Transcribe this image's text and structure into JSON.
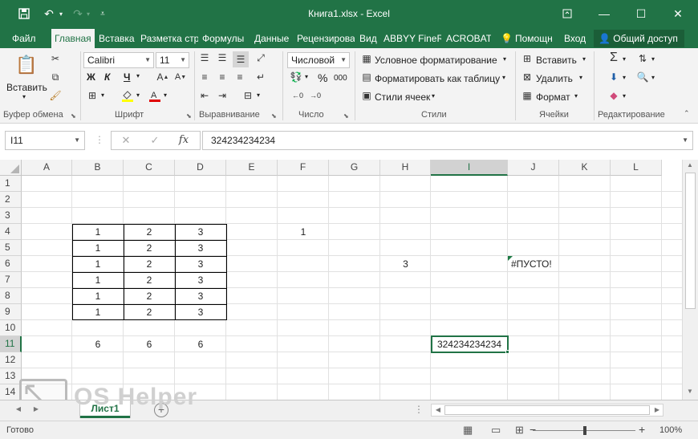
{
  "window": {
    "title": "Книга1.xlsx - Excel",
    "accent": "#217346"
  },
  "tabs": [
    "Файл",
    "Главная",
    "Вставка",
    "Разметка стр",
    "Формулы",
    "Данные",
    "Рецензирова",
    "Вид",
    "ABBYY FineR",
    "ACROBAT",
    "Помощн",
    "Вход"
  ],
  "active_tab": "Главная",
  "share_label": "Общий доступ",
  "ribbon": {
    "paste_label": "Вставить",
    "font_name": "Calibri",
    "font_size": "11",
    "bold": "Ж",
    "italic": "К",
    "underline": "Ч",
    "number_format": "Числовой",
    "percent": "%",
    "thousands": "000",
    "cond_format": "Условное форматирование",
    "format_table": "Форматировать как таблицу",
    "cell_styles": "Стили ячеек",
    "insert": "Вставить",
    "delete": "Удалить",
    "format": "Формат",
    "groups": [
      "Буфер обмена",
      "Шрифт",
      "Выравнивание",
      "Число",
      "Стили",
      "Ячейки",
      "Редактирование"
    ]
  },
  "formula_bar": {
    "name_box": "I11",
    "fx": "fx",
    "value": "324234234234"
  },
  "columns": [
    "A",
    "B",
    "C",
    "D",
    "E",
    "F",
    "G",
    "H",
    "I",
    "J",
    "K",
    "L"
  ],
  "rows": [
    "1",
    "2",
    "3",
    "4",
    "5",
    "6",
    "7",
    "8",
    "9",
    "10",
    "11",
    "12",
    "13",
    "14"
  ],
  "cells": {
    "B4": "1",
    "C4": "2",
    "D4": "3",
    "B5": "1",
    "C5": "2",
    "D5": "3",
    "B6": "1",
    "C6": "2",
    "D6": "3",
    "B7": "1",
    "C7": "2",
    "D7": "3",
    "B8": "1",
    "C8": "2",
    "D8": "3",
    "B9": "1",
    "C9": "2",
    "D9": "3",
    "F4": "1",
    "H6": "3",
    "J6": "#ПУСТО!",
    "B11": "6",
    "C11": "6",
    "D11": "6",
    "I11": "324234234234"
  },
  "sheet_tab": "Лист1",
  "status": {
    "ready": "Готово",
    "zoom": "100%"
  },
  "watermark": "OS Helper"
}
